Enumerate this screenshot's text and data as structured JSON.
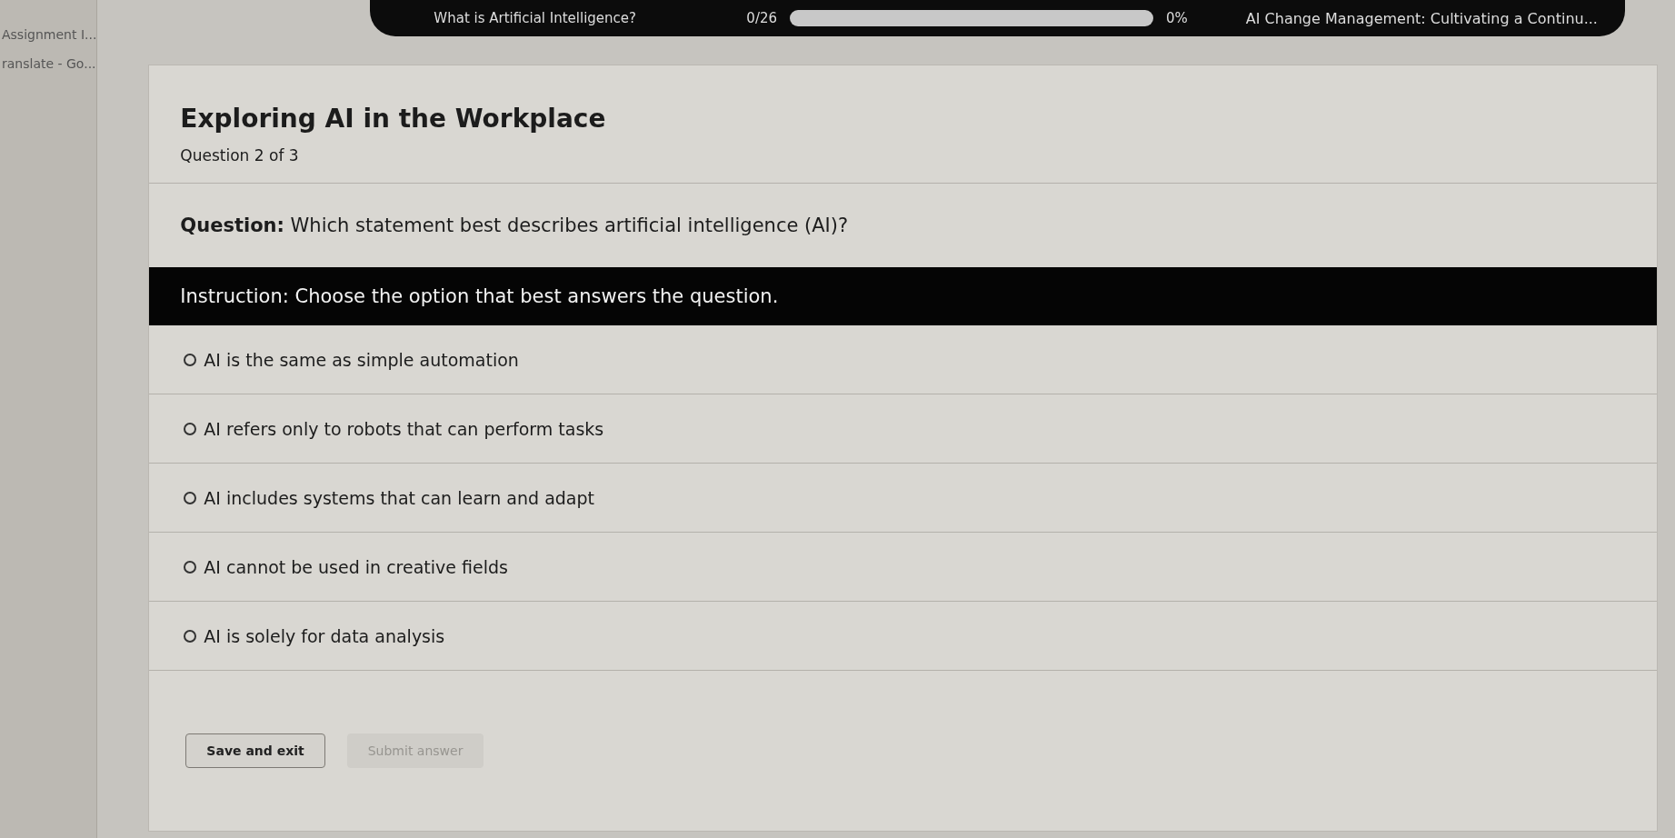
{
  "sidebar": {
    "items": [
      {
        "label": "Assignment I..."
      },
      {
        "label": "ranslate - Go..."
      }
    ]
  },
  "top_bar": {
    "lesson": "What is Artificial Intelligence?",
    "count": "0/26",
    "progress": {
      "level": 0,
      "reading": "0%"
    },
    "course": "AI Change Management: Cultivating a Continu..."
  },
  "quiz": {
    "title": "Exploring AI in the Workplace",
    "subtitle": "Question 2 of 3",
    "question": "**Question:** Which statement best describes artificial intelligence (AI)?",
    "instruction": "Instruction: Choose the option that best answers the question.",
    "options": [
      {
        "label": "AI is the same as simple automation",
        "selected": false
      },
      {
        "label": "AI refers only to robots that can perform tasks",
        "selected": false
      },
      {
        "label": "AI includes systems that can learn and adapt",
        "selected": false
      },
      {
        "label": "AI cannot be used in creative fields",
        "selected": false
      },
      {
        "label": "AI is solely for data analysis",
        "selected": false
      }
    ]
  },
  "buttons": [
    {
      "label": "Save and exit",
      "disabled": false
    },
    {
      "label": "Submit answer",
      "disabled": true
    }
  ]
}
